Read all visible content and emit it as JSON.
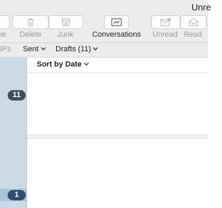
{
  "window": {
    "title": "Unre"
  },
  "toolbar": {
    "move_label": "ve",
    "delete_label": "Delete",
    "junk_label": "Junk",
    "conversations_label": "Conversations",
    "unread_label": "Unread",
    "read_label": "Read",
    "icons": {
      "delete": "trash-icon",
      "junk": "junk-icon",
      "conversations": "conversations-icon",
      "unread": "envelope-unread-icon",
      "read": "envelope-open-icon"
    }
  },
  "favorites": {
    "vips_label": "IPs",
    "sent_label": "Sent",
    "drafts_label": "Drafts (11)"
  },
  "sidebar": {
    "badges": [
      "11",
      "1"
    ]
  },
  "message_list": {
    "sort_label": "Sort by Date"
  },
  "colors": {
    "sidebar_bg": "#cbdbe6",
    "badge_bg": "#3e4f5e",
    "toolbar_bg": "#ececec"
  }
}
